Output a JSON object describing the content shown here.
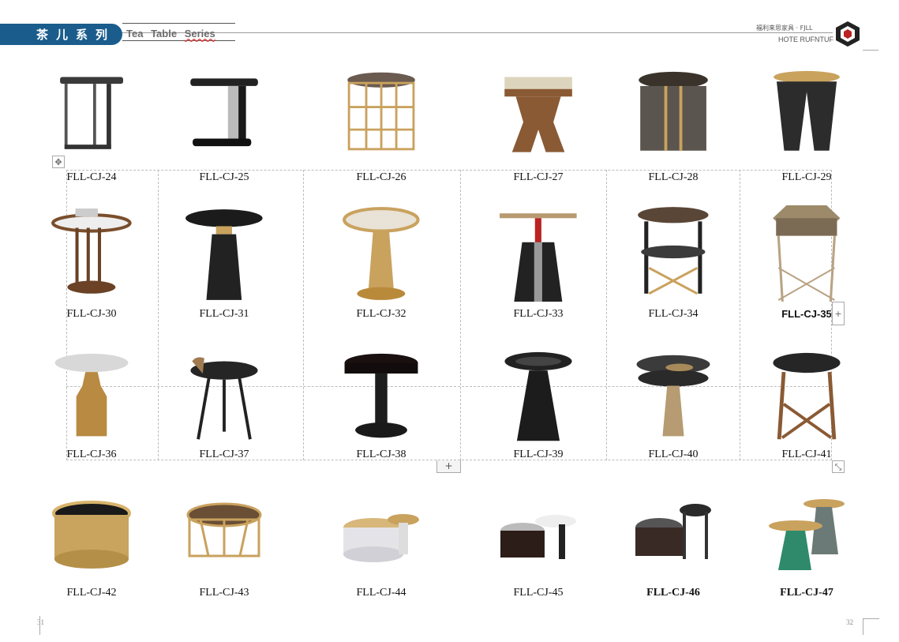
{
  "header": {
    "tab_title": "茶儿系列",
    "series_en": [
      "Tea",
      "Table",
      "Series"
    ],
    "brand_cn": "福利来思家具 · FJLL",
    "brand_en": "HOTE RUFNTUF"
  },
  "colors": {
    "tab_blue": "#1a5d8c",
    "wood": "#8a5a34",
    "gold": "#c9a25e",
    "black": "#1c1c1c"
  },
  "icons": [
    "move-handle-icon",
    "add-column-icon",
    "add-row-icon",
    "resize-handle-icon",
    "brand-logo-icon"
  ],
  "products": [
    {
      "code": "FLL-CJ-24",
      "kind": "side-c"
    },
    {
      "code": "FLL-CJ-25",
      "kind": "side-c-black"
    },
    {
      "code": "FLL-CJ-26",
      "kind": "cage"
    },
    {
      "code": "FLL-CJ-27",
      "kind": "wood-square"
    },
    {
      "code": "FLL-CJ-28",
      "kind": "drum"
    },
    {
      "code": "FLL-CJ-29",
      "kind": "tri-leg"
    },
    {
      "code": "FLL-CJ-30",
      "kind": "marble-rods"
    },
    {
      "code": "FLL-CJ-31",
      "kind": "cone-black"
    },
    {
      "code": "FLL-CJ-32",
      "kind": "gold-pedestal"
    },
    {
      "code": "FLL-CJ-33",
      "kind": "red-cone"
    },
    {
      "code": "FLL-CJ-34",
      "kind": "two-tier"
    },
    {
      "code": "FLL-CJ-35",
      "kind": "hexagon"
    },
    {
      "code": "FLL-CJ-36",
      "kind": "marble-gold"
    },
    {
      "code": "FLL-CJ-37",
      "kind": "tripod"
    },
    {
      "code": "FLL-CJ-38",
      "kind": "black-pedestal"
    },
    {
      "code": "FLL-CJ-39",
      "kind": "black-cone"
    },
    {
      "code": "FLL-CJ-40",
      "kind": "layered"
    },
    {
      "code": "FLL-CJ-41",
      "kind": "wood-cross"
    },
    {
      "code": "FLL-CJ-42",
      "kind": "gold-drum"
    },
    {
      "code": "FLL-CJ-43",
      "kind": "gold-ring"
    },
    {
      "code": "FLL-CJ-44",
      "kind": "nest-white"
    },
    {
      "code": "FLL-CJ-45",
      "kind": "nest-dark"
    },
    {
      "code": "FLL-CJ-46",
      "kind": "nest-grey"
    },
    {
      "code": "FLL-CJ-47",
      "kind": "nest-gold"
    }
  ],
  "page_numbers": {
    "left": "31",
    "right": "32"
  },
  "controls": {
    "add_column": "+",
    "add_row": "+"
  }
}
